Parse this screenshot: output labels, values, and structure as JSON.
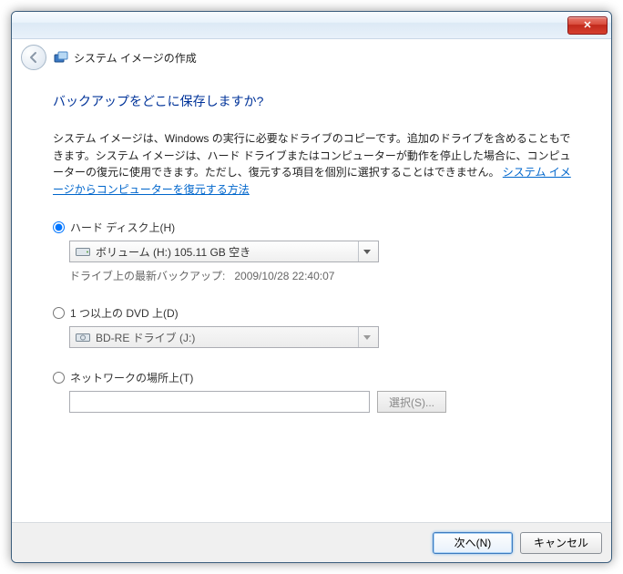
{
  "window": {
    "title": "システム イメージの作成",
    "close_glyph": "✕"
  },
  "main": {
    "question": "バックアップをどこに保存しますか?",
    "description_pre": "システム イメージは、Windows の実行に必要なドライブのコピーです。追加のドライブを含めることもできます。システム イメージは、ハード ドライブまたはコンピューターが動作を停止した場合に、コンピューターの復元に使用できます。ただし、復元する項目を個別に選択することはできません。",
    "description_link": "システム イメージからコンピューターを復元する方法"
  },
  "options": {
    "hdd": {
      "label": "ハード ディスク上(H)",
      "selected": "ボリューム (H:)  105.11 GB 空き",
      "latest_backup_label": "ドライブ上の最新バックアップ:",
      "latest_backup_value": "2009/10/28 22:40:07"
    },
    "dvd": {
      "label": "1 つ以上の DVD 上(D)",
      "selected": "BD-RE ドライブ (J:)"
    },
    "network": {
      "label": "ネットワークの場所上(T)",
      "placeholder": "",
      "choose_button": "選択(S)..."
    }
  },
  "footer": {
    "next": "次へ(N)",
    "cancel": "キャンセル"
  },
  "icons": {
    "back": "back-arrow-icon",
    "app": "system-image-icon",
    "drive": "hard-drive-icon",
    "optical": "optical-drive-icon",
    "caret": "chevron-down-icon"
  }
}
